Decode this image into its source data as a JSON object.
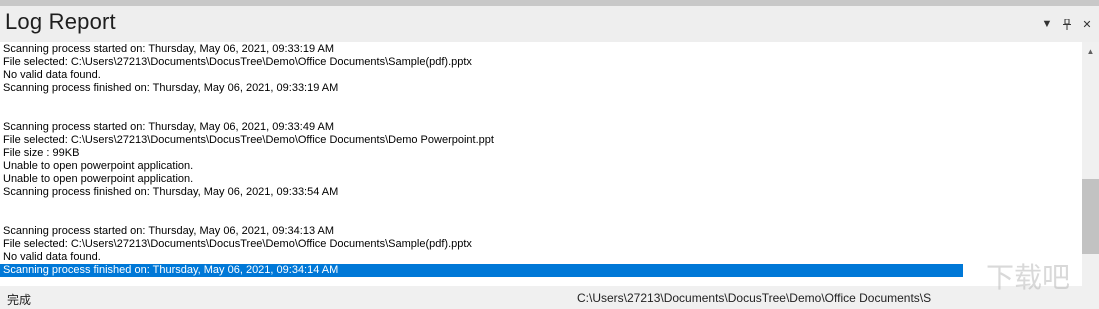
{
  "panel": {
    "title": "Log Report"
  },
  "log": [
    "Scanning process started on: Thursday, May 06, 2021, 09:33:19 AM",
    "File selected: C:\\Users\\27213\\Documents\\DocusTree\\Demo\\Office Documents\\Sample(pdf).pptx",
    "No valid data found.",
    "Scanning process finished on: Thursday, May 06, 2021, 09:33:19 AM",
    "",
    "",
    "Scanning process started on: Thursday, May 06, 2021, 09:33:49 AM",
    "File selected: C:\\Users\\27213\\Documents\\DocusTree\\Demo\\Office Documents\\Demo Powerpoint.ppt",
    "File size : 99KB",
    "Unable to open powerpoint application.",
    "Unable to open powerpoint application.",
    "Scanning process finished on: Thursday, May 06, 2021, 09:33:54 AM",
    "",
    "",
    "Scanning process started on: Thursday, May 06, 2021, 09:34:13 AM",
    "File selected: C:\\Users\\27213\\Documents\\DocusTree\\Demo\\Office Documents\\Sample(pdf).pptx",
    "No valid data found.",
    "Scanning process finished on: Thursday, May 06, 2021, 09:34:14 AM"
  ],
  "status": {
    "left": "完成",
    "right": "C:\\Users\\27213\\Documents\\DocusTree\\Demo\\Office Documents\\S"
  },
  "watermark": "下载吧",
  "colors": {
    "selection": "#0078d7",
    "background": "#ffffff"
  }
}
